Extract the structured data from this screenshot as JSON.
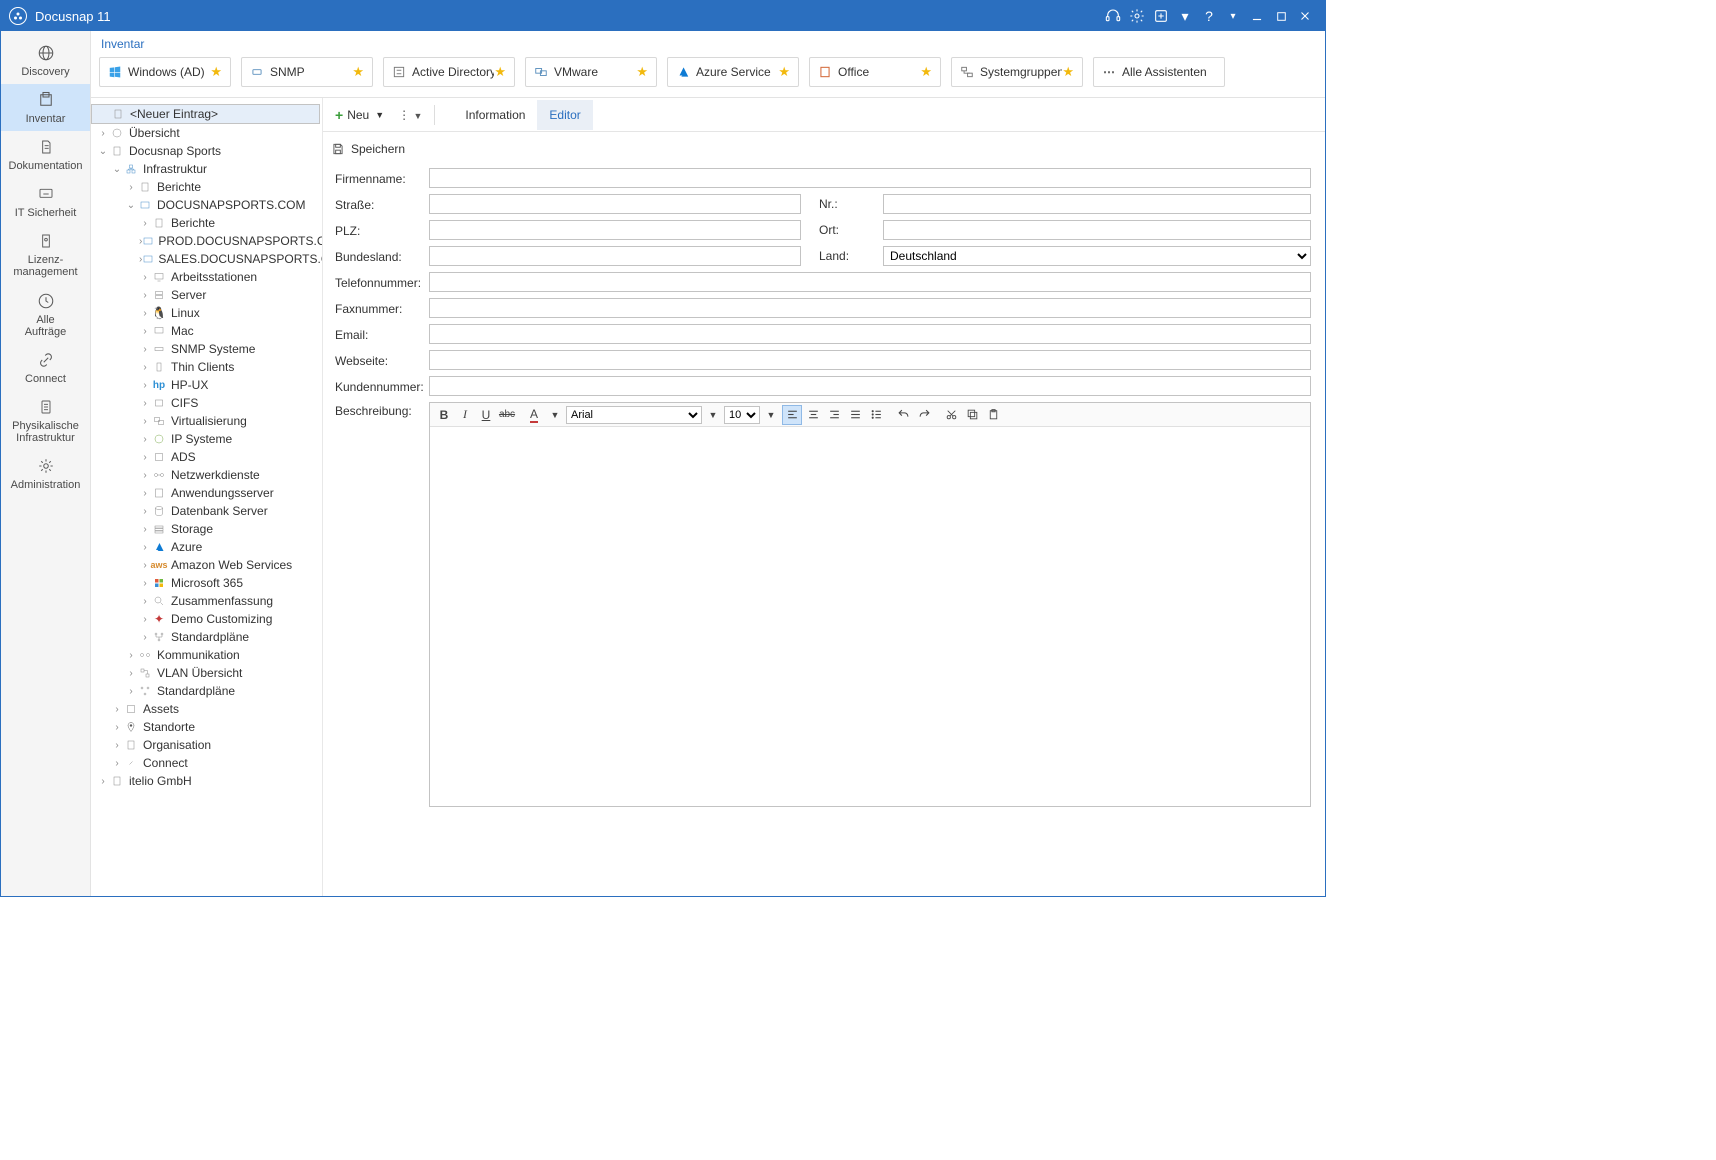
{
  "app": {
    "title": "Docusnap 11"
  },
  "crumb": "Inventar",
  "nav": {
    "discovery": "Discovery",
    "inventar": "Inventar",
    "dokumentation": "Dokumentation",
    "it_sicherheit": "IT Sicherheit",
    "lizenz": "Lizenz-\nmanagement",
    "auftraege": "Alle\nAufträge",
    "connect": "Connect",
    "phys": "Physikalische\nInfrastruktur",
    "admin": "Administration"
  },
  "assistants": {
    "windows": "Windows (AD)",
    "snmp": "SNMP",
    "ad": "Active Directory",
    "vmware": "VMware",
    "azure": "Azure Service",
    "office": "Office",
    "sysgrp": "Systemgruppen",
    "all": "Alle Assistenten"
  },
  "etoolbar": {
    "new": "Neu",
    "tab_info": "Information",
    "tab_editor": "Editor"
  },
  "save": "Speichern",
  "form": {
    "firma_l": "Firmenname:",
    "strasse_l": "Straße:",
    "nr_l": "Nr.:",
    "plz_l": "PLZ:",
    "ort_l": "Ort:",
    "bundesland_l": "Bundesland:",
    "land_l": "Land:",
    "land_v": "Deutschland",
    "tel_l": "Telefonnummer:",
    "fax_l": "Faxnummer:",
    "email_l": "Email:",
    "web_l": "Webseite:",
    "kunden_l": "Kundennummer:",
    "beschr_l": "Beschreibung:"
  },
  "rte": {
    "font": "Arial",
    "size": "10"
  },
  "tree": {
    "neuer": "<Neuer Eintrag>",
    "uebersicht": "Übersicht",
    "sports": "Docusnap Sports",
    "infra": "Infrastruktur",
    "berichte": "Berichte",
    "dom": "DOCUSNAPSPORTS.COM",
    "berichte2": "Berichte",
    "prod": "PROD.DOCUSNAPSPORTS.COM",
    "sales": "SALES.DOCUSNAPSPORTS.COM",
    "arbeits": "Arbeitsstationen",
    "server": "Server",
    "linux": "Linux",
    "mac": "Mac",
    "snmp": "SNMP Systeme",
    "thin": "Thin Clients",
    "hpux": "HP-UX",
    "cifs": "CIFS",
    "virt": "Virtualisierung",
    "ip": "IP Systeme",
    "ads": "ADS",
    "netz": "Netzwerkdienste",
    "anw": "Anwendungsserver",
    "db": "Datenbank Server",
    "storage": "Storage",
    "azure": "Azure",
    "aws": "Amazon Web Services",
    "m365": "Microsoft 365",
    "zusam": "Zusammenfassung",
    "demo": "Demo Customizing",
    "stdpl": "Standardpläne",
    "komm": "Kommunikation",
    "vlan": "VLAN Übersicht",
    "stdpl2": "Standardpläne",
    "assets": "Assets",
    "stand": "Standorte",
    "org": "Organisation",
    "connect": "Connect",
    "itelio": "itelio GmbH"
  }
}
